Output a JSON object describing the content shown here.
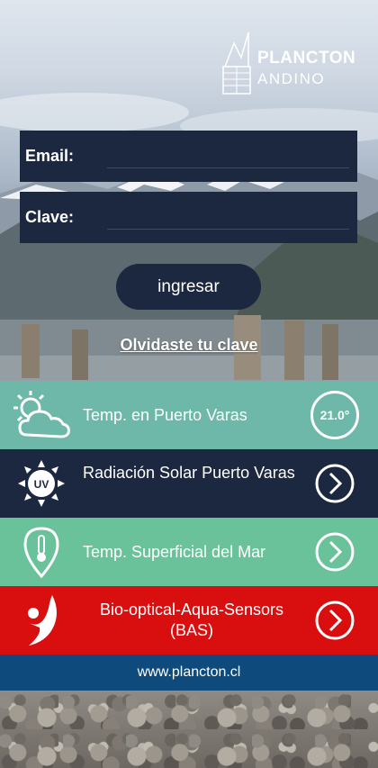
{
  "logo": {
    "line1": "PLANCTON",
    "line2": "ANDINO"
  },
  "login": {
    "email_label": "Email:",
    "email_value": "",
    "password_label": "Clave:",
    "password_value": "",
    "submit_label": "ingresar",
    "forgot_label": "Olvidaste tu clave"
  },
  "menu": [
    {
      "label": "Temp. en Puerto Varas",
      "badge": "21.0°",
      "icon": "weather-cloud-sun-icon",
      "color": "#6db8a8"
    },
    {
      "label": "Radiación Solar Puerto Varas",
      "icon": "uv-sun-icon",
      "color": "#1c2740"
    },
    {
      "label": "Temp. Superficial del Mar",
      "icon": "thermometer-pin-icon",
      "color": "#69c29a"
    },
    {
      "label": "Bio-optical-Aqua-Sensors (BAS)",
      "icon": "person-logo-icon",
      "color": "#d80e0f"
    }
  ],
  "footer": {
    "link": "www.plancton.cl",
    "color": "#0e4b7c"
  }
}
